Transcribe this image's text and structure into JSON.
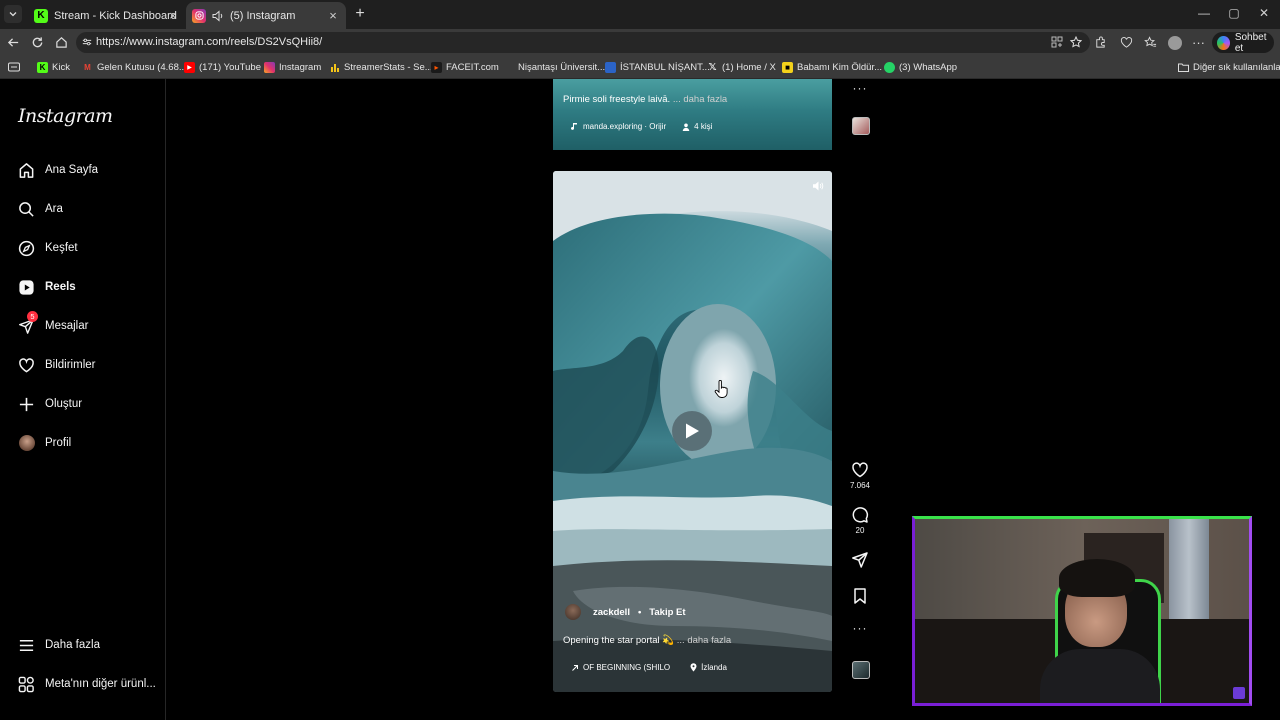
{
  "browser": {
    "tabs": [
      {
        "title": "Stream - Kick Dashboard",
        "favicon": "kick-icon",
        "active": false
      },
      {
        "title": "(5) Instagram",
        "favicon": "instagram-icon",
        "active": true
      }
    ],
    "url": "https://www.instagram.com/reels/DS2VsQHii8/",
    "copilot_label": "Sohbet et",
    "bookmarks": [
      {
        "label": "Kick",
        "icon": "kick-icon",
        "color": "#53fc18"
      },
      {
        "label": "Gelen Kutusu (4.68...",
        "icon": "gmail-icon",
        "color": "#ea4335"
      },
      {
        "label": "(171) YouTube",
        "icon": "youtube-icon",
        "color": "#ff0000"
      },
      {
        "label": "Instagram",
        "icon": "instagram-icon",
        "color": "#e1306c"
      },
      {
        "label": "StreamerStats - Se...",
        "icon": "stats-icon",
        "color": "#f5c518"
      },
      {
        "label": "FACEIT.com",
        "icon": "faceit-icon",
        "color": "#ff5500"
      },
      {
        "label": "Nişantaşı Üniversit...",
        "icon": "university-icon",
        "color": "#6b6b6b"
      },
      {
        "label": "İSTANBUL NİŞANT...",
        "icon": "university-icon",
        "color": "#2b63c6"
      },
      {
        "label": "(1) Home / X",
        "icon": "x-icon",
        "color": "#ffffff"
      },
      {
        "label": "Babamı Kim Öldür...",
        "icon": "film-icon",
        "color": "#f3d21b"
      },
      {
        "label": "(3) WhatsApp",
        "icon": "whatsapp-icon",
        "color": "#25d366"
      }
    ],
    "other_bookmarks": "Diğer sık kullanılanlar"
  },
  "sidebar": {
    "brand": "Instagram",
    "items": [
      {
        "label": "Ana Sayfa",
        "icon": "home-icon"
      },
      {
        "label": "Ara",
        "icon": "search-icon"
      },
      {
        "label": "Keşfet",
        "icon": "compass-icon"
      },
      {
        "label": "Reels",
        "icon": "reels-icon",
        "active": true
      },
      {
        "label": "Mesajlar",
        "icon": "messages-icon",
        "badge": "5"
      },
      {
        "label": "Bildirimler",
        "icon": "heart-icon"
      },
      {
        "label": "Oluştur",
        "icon": "plus-icon"
      },
      {
        "label": "Profil",
        "icon": "avatar"
      }
    ],
    "more": "Daha fazla",
    "meta": "Meta'nın diğer ürünl..."
  },
  "reel_prev": {
    "caption": "Pirmie soli freestyle laivā.",
    "more": "... daha fazla",
    "audio": "manda.exploring · Orijir",
    "people": "4 kişi"
  },
  "reel": {
    "username": "zackdell",
    "follow": "Takip Et",
    "caption": "Opening the star portal 💫",
    "more": "... daha fazla",
    "audio": "OF BEGINNING (SHILO",
    "location": "İzlanda",
    "likes": "7.064",
    "comments": "20"
  }
}
